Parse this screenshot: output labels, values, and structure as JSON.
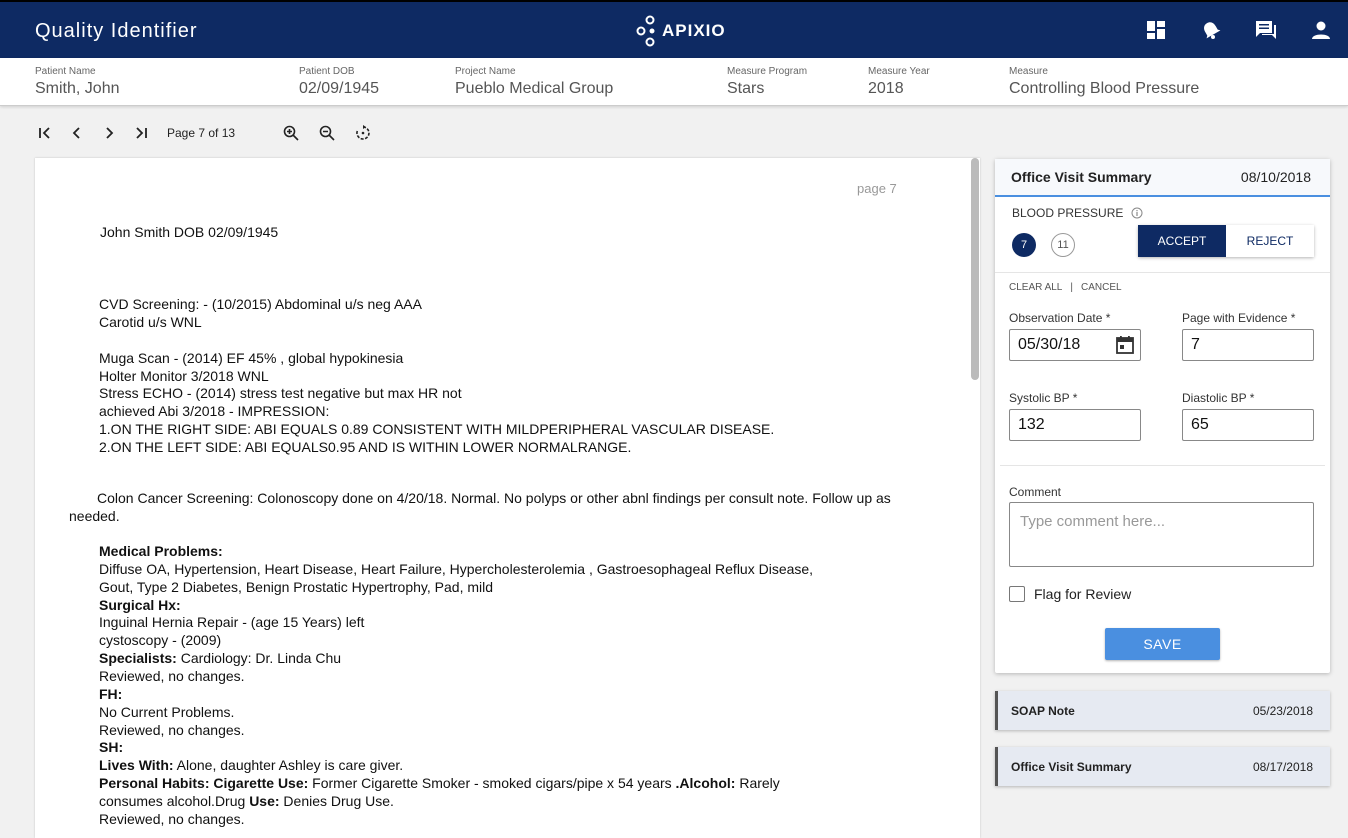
{
  "app": {
    "title": "Quality Identifier",
    "logo_text": "APIXIO"
  },
  "topbar_icons": [
    "dashboard-icon",
    "notifications-icon",
    "chat-icon",
    "account-icon"
  ],
  "patient": {
    "name_label": "Patient Name",
    "name": "Smith, John",
    "dob_label": "Patient DOB",
    "dob": "02/09/1945",
    "project_label": "Project Name",
    "project": "Pueblo Medical Group",
    "program_label": "Measure Program",
    "program": "Stars",
    "year_label": "Measure Year",
    "year": "2018",
    "measure_label": "Measure",
    "measure": "Controlling Blood Pressure"
  },
  "toolbar": {
    "page_info": "Page 7 of 13"
  },
  "document": {
    "page_label": "page 7",
    "header": "John Smith  DOB 02/09/1945",
    "cvd1": "CVD Screening: - (10/2015) Abdominal u/s neg AAA",
    "cvd2": "Carotid u/s WNL",
    "muga": "Muga Scan - (2014) EF 45% , global hypokinesia",
    "holter": "Holter Monitor 3/2018 WNL",
    "stress": "Stress ECHO - (2014) stress test negative but max HR not",
    "abi": "achieved Abi 3/2018 - IMPRESSION:",
    "imp1": "1.ON THE RIGHT SIDE: ABI EQUALS 0.89 CONSISTENT WITH MILDPERIPHERAL VASCULAR DISEASE.",
    "imp2": "2.ON THE LEFT SIDE: ABI EQUALS0.95 AND IS WITHIN LOWER NORMALRANGE.",
    "colon1": "Colon Cancer Screening:  Colonoscopy done on 4/20/18.  Normal.  No polyps or other abnl findings per consult note.  Follow up as",
    "colon2": "needed.",
    "mp_h": "Medical Problems:",
    "mp1": "Diffuse OA, Hypertension, Heart Disease, Heart Failure, Hypercholesterolemia , Gastroesophageal Reflux Disease,",
    "mp2": "Gout, Type 2 Diabetes, Benign Prostatic Hypertrophy, Pad, mild",
    "sh_h": "Surgical Hx:",
    "sh1": "Inguinal Hernia Repair - (age 15 Years) left",
    "sh2": "cystoscopy - (2009)",
    "spec_h": "Specialists:",
    "spec": " Cardiology: Dr. Linda Chu",
    "rev1": "Reviewed, no changes.",
    "fh_h": "FH:",
    "fh1": "No Current Problems.",
    "rev2": "Reviewed, no changes.",
    "soc_h": "SH:",
    "lw_h": "Lives With:",
    "lw": " Alone, daughter Ashley is care giver.",
    "ph_h": "Personal Habits: Cigarette Use:",
    "ph": " Former Cigarette Smoker - smoked cigars/pipe x 54 years ",
    "alc_h": ".Alcohol:",
    "alc": " Rarely",
    "cons1": "consumes alcohol.Drug ",
    "use_h": "Use:",
    "cons2": " Denies Drug Use.",
    "rev3": "Reviewed, no changes."
  },
  "panel": {
    "title": "Office Visit Summary",
    "date": "08/10/2018",
    "bp_label": "BLOOD PRESSURE",
    "badge_active": "7",
    "badge_other": "11",
    "accept": "ACCEPT",
    "reject": "REJECT",
    "clear_all": "CLEAR ALL",
    "separator": "|",
    "cancel": "CANCEL",
    "obs_label": "Observation Date *",
    "obs_value": "05/30/18",
    "page_label": "Page with Evidence *",
    "page_value": "7",
    "sys_label": "Systolic BP *",
    "sys_value": "132",
    "dia_label": "Diastolic BP *",
    "dia_value": "65",
    "comment_label": "Comment",
    "comment_placeholder": "Type comment here...",
    "flag_label": "Flag for Review",
    "save": "SAVE"
  },
  "cards": [
    {
      "title": "SOAP Note",
      "date": "05/23/2018"
    },
    {
      "title": "Office Visit Summary",
      "date": "08/17/2018"
    }
  ]
}
